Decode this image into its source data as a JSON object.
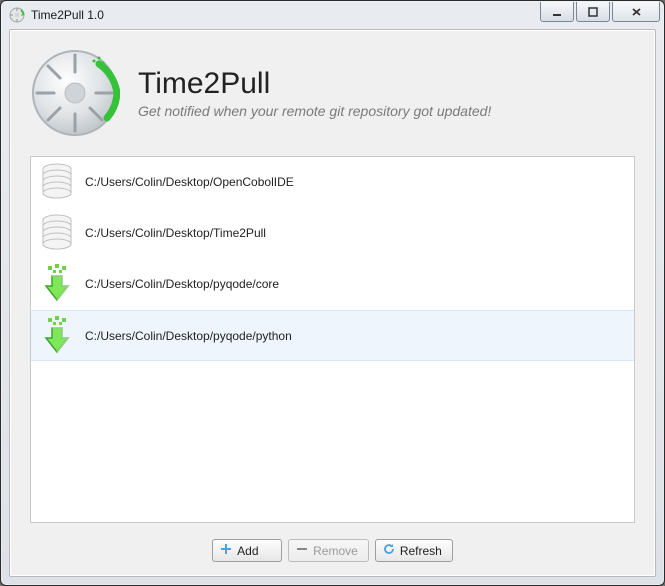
{
  "window": {
    "title": "Time2Pull 1.0"
  },
  "header": {
    "app_name": "Time2Pull",
    "subtitle": "Get notified when your remote git repository got updated!"
  },
  "repos": [
    {
      "path": "C:/Users/Colin/Desktop/OpenCobolIDE",
      "status": "clean",
      "selected": false
    },
    {
      "path": "C:/Users/Colin/Desktop/Time2Pull",
      "status": "clean",
      "selected": false
    },
    {
      "path": "C:/Users/Colin/Desktop/pyqode/core",
      "status": "pull",
      "selected": false
    },
    {
      "path": "C:/Users/Colin/Desktop/pyqode/python",
      "status": "pull",
      "selected": true
    }
  ],
  "buttons": {
    "add": "Add",
    "remove": "Remove",
    "refresh": "Refresh",
    "remove_enabled": false
  }
}
